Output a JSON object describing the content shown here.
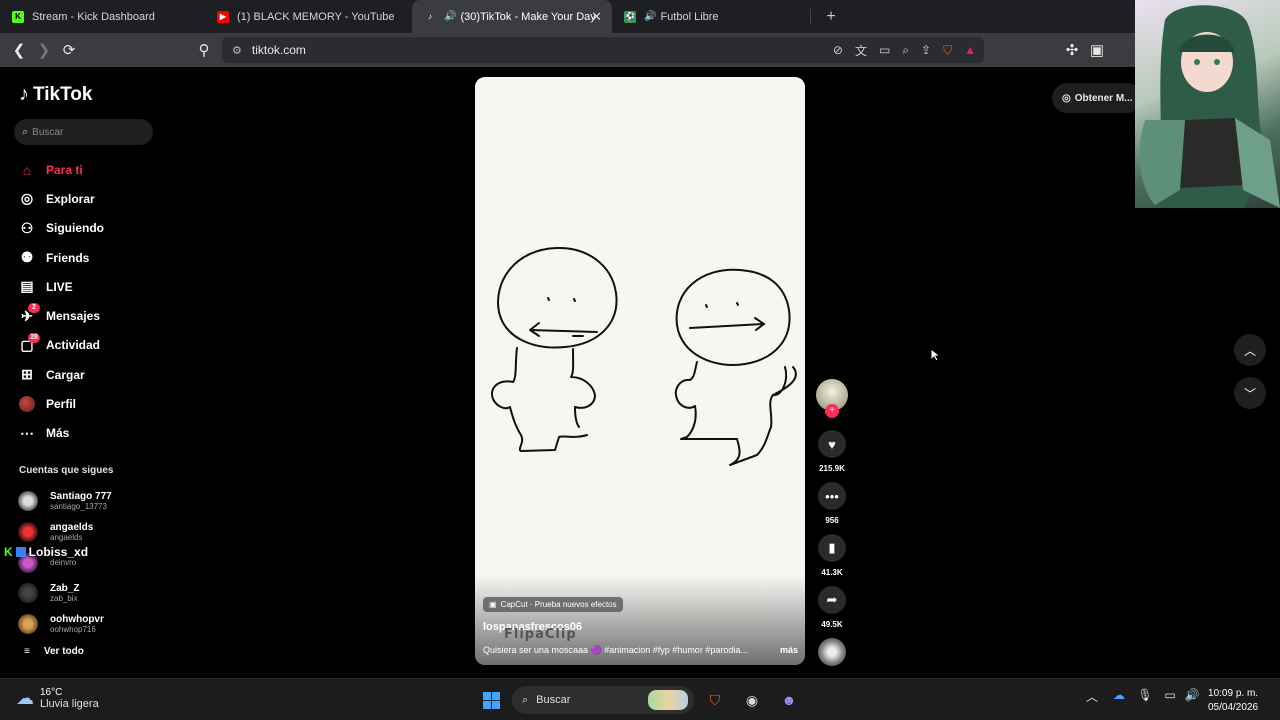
{
  "browser": {
    "tabs": [
      {
        "title": "Stream - Kick Dashboard",
        "favicon": "kick-icon",
        "color": "#53fc18",
        "active": false
      },
      {
        "title": "(1) BLACK MEMORY - YouTube",
        "favicon": "youtube-icon",
        "color": "#ff0000",
        "active": false
      },
      {
        "title": "(30)TikTok - Make Your Day",
        "favicon": "tiktok-icon",
        "color": "#ffffff",
        "active": true
      },
      {
        "title": "Futbol Libre",
        "favicon": "soccer-icon",
        "color": "#2e9e4f",
        "active": false
      }
    ],
    "new_tab": "+",
    "url": "tiktok.com"
  },
  "tiktok": {
    "logo": "TikTok",
    "search_placeholder": "Buscar",
    "nav": [
      {
        "label": "Para ti",
        "icon": "home-icon",
        "active": true
      },
      {
        "label": "Explorar",
        "icon": "compass-icon"
      },
      {
        "label": "Siguiendo",
        "icon": "following-icon"
      },
      {
        "label": "Friends",
        "icon": "friends-icon"
      },
      {
        "label": "LIVE",
        "icon": "live-icon"
      },
      {
        "label": "Mensajes",
        "icon": "messages-icon",
        "badge": "2"
      },
      {
        "label": "Actividad",
        "icon": "activity-icon",
        "badge": "28"
      },
      {
        "label": "Cargar",
        "icon": "upload-icon"
      },
      {
        "label": "Perfil",
        "icon": "profile-icon"
      },
      {
        "label": "Más",
        "icon": "more-icon"
      }
    ],
    "following_title": "Cuentas que sigues",
    "following": [
      {
        "name": "Santiago 777",
        "handle": "santiago_13773"
      },
      {
        "name": "angaelds",
        "handle": "angaelds"
      },
      {
        "name": "",
        "handle": "deinvro"
      },
      {
        "name": "Zab_Z",
        "handle": "zab_bix"
      },
      {
        "name": "oohwhopvr",
        "handle": "oohwhop716"
      }
    ],
    "see_all": "Ver todo",
    "get_app": "Obtener M...",
    "video": {
      "effect_tag": "CapCut · Prueba nuevos efectos",
      "author": "lospanasfrescos06",
      "description": "Quisiera ser una moscaaa 🟣 #animacion #fyp #humor #parodia...",
      "more": "más",
      "watermark": "FlipaClip"
    },
    "actions": {
      "likes": "215.9K",
      "comments": "956",
      "saves": "41.3K",
      "shares": "49.5K"
    }
  },
  "stream_overlay": {
    "username": "Lobiss_xd"
  },
  "taskbar": {
    "weather_temp": "16°C",
    "weather_desc": "Lluvia ligera",
    "search_placeholder": "Buscar",
    "time": "10:09 p. m.",
    "date": "05/04/2026"
  }
}
